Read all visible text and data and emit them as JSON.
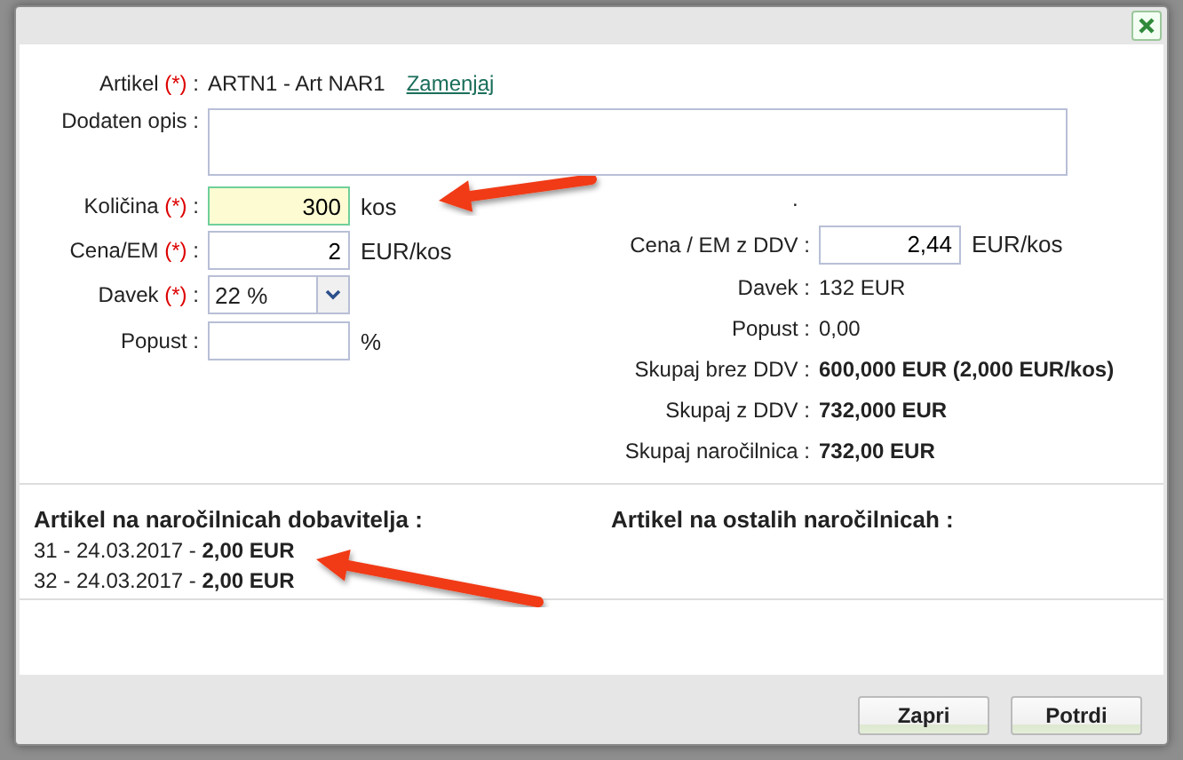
{
  "article": {
    "label": "Artikel",
    "required_mark": "(*)",
    "suffix": ":",
    "value": "ARTN1 - Art NAR1",
    "link": "Zamenjaj"
  },
  "description": {
    "label": "Dodaten opis",
    "suffix": ":"
  },
  "left_fields": [
    {
      "kind": "input",
      "label": "Količina",
      "required_mark": "(*)",
      "suffix": ":",
      "value": "300",
      "unit": "kos",
      "highlighted": true
    },
    {
      "kind": "input",
      "label": "Cena/EM",
      "required_mark": "(*)",
      "suffix": ":",
      "value": "2",
      "unit": "EUR/kos",
      "highlighted": false
    },
    {
      "kind": "select",
      "label": "Davek",
      "required_mark": "(*)",
      "suffix": ":",
      "value": "22 %"
    },
    {
      "kind": "input",
      "label": "Popust",
      "suffix": ":",
      "unit": "%",
      "highlighted": false
    }
  ],
  "right_note": ".",
  "right_fields": [
    {
      "kind": "input",
      "label": "Cena / EM z DDV",
      "suffix": ":",
      "value": "2,44",
      "unit": "EUR/kos"
    },
    {
      "kind": "text",
      "label": "Davek",
      "suffix": ":",
      "value": "132 EUR",
      "bold": false
    },
    {
      "kind": "text",
      "label": "Popust",
      "suffix": ":",
      "value": "0,00",
      "bold": false
    },
    {
      "kind": "text",
      "label": "Skupaj brez DDV",
      "suffix": ":",
      "value": "600,000 EUR (2,000 EUR/kos)",
      "bold": true
    },
    {
      "kind": "text",
      "label": "Skupaj z DDV",
      "suffix": ":",
      "value": "732,000 EUR",
      "bold": true
    },
    {
      "kind": "text",
      "label": "Skupaj naročilnica",
      "suffix": ":",
      "value": "732,00 EUR",
      "bold": true
    }
  ],
  "history": [
    {
      "title": "Artikel na naročilnicah dobavitelja :",
      "entries": [
        "31 - 24.03.2017 - **2,00 EUR**",
        "32 - 24.03.2017 - **2,00 EUR**"
      ]
    },
    {
      "title": "Artikel na ostalih naročilnicah :"
    }
  ],
  "buttons": [
    "Zapri",
    "Potrdi"
  ]
}
